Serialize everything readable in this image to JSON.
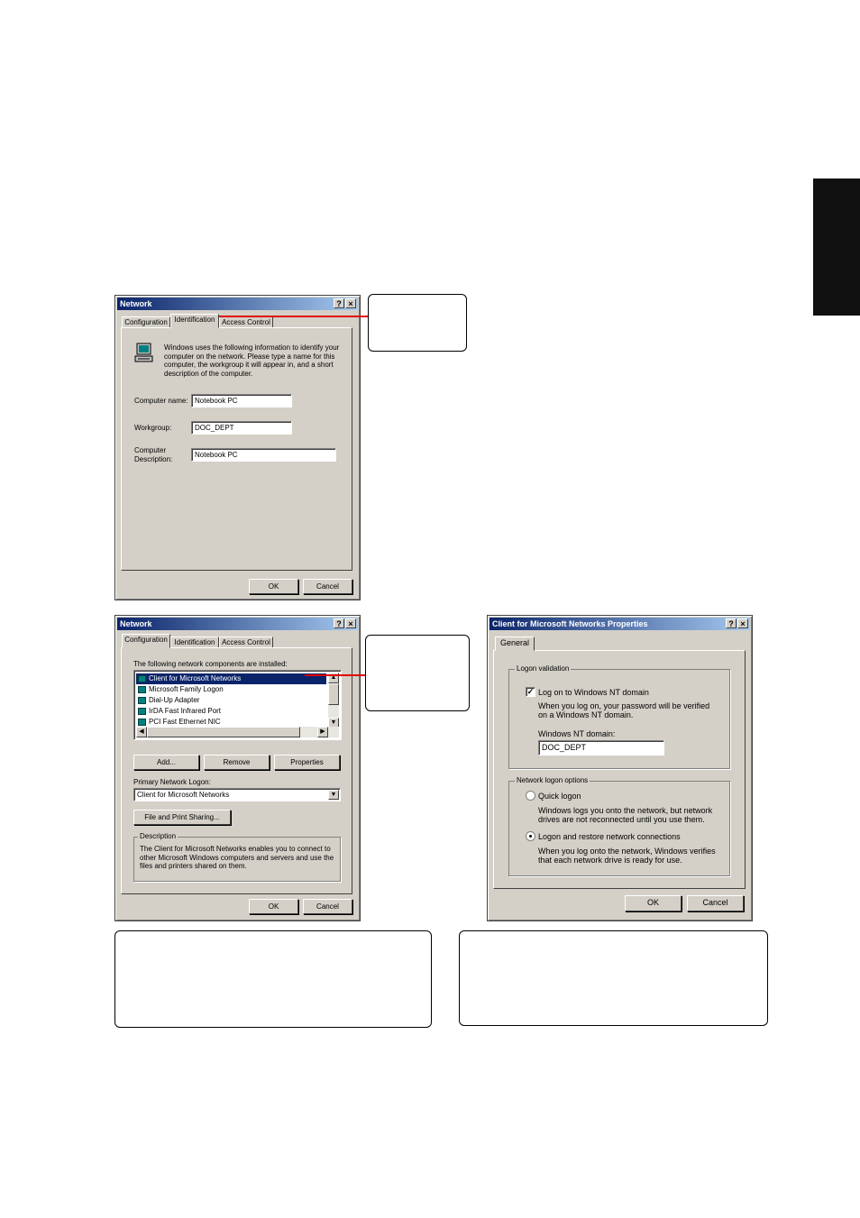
{
  "dialog1": {
    "title": "Network",
    "help_btn": "?",
    "close_btn": "×",
    "tabs": [
      "Configuration",
      "Identification",
      "Access Control"
    ],
    "intro": "Windows uses the following information to identify your computer on the network.  Please type a name for this computer, the workgroup it will appear in, and a short description of the computer.",
    "computer_name_label": "Computer name:",
    "computer_name_value": "Notebook PC",
    "workgroup_label": "Workgroup:",
    "workgroup_value": "DOC_DEPT",
    "description_label_1": "Computer",
    "description_label_2": "Description:",
    "description_value": "Notebook PC",
    "ok": "OK",
    "cancel": "Cancel"
  },
  "dialog2": {
    "title": "Network",
    "help_btn": "?",
    "close_btn": "×",
    "tabs": [
      "Configuration",
      "Identification",
      "Access Control"
    ],
    "list_label": "The following network components are installed:",
    "components": [
      "Client for Microsoft Networks",
      "Microsoft Family Logon",
      "Dial-Up Adapter",
      "IrDA Fast Infrared Port",
      "PCI Fast Ethernet NIC"
    ],
    "add": "Add...",
    "remove": "Remove",
    "properties": "Properties",
    "primary_logon_label": "Primary Network Logon:",
    "primary_logon_value": "Client for Microsoft Networks",
    "file_print": "File and Print Sharing...",
    "description_title": "Description",
    "description_text": "The Client for Microsoft Networks enables you to connect to other Microsoft Windows computers and servers and use the files and printers shared on them.",
    "ok": "OK",
    "cancel": "Cancel"
  },
  "dialog3": {
    "title": "Client for Microsoft Networks Properties",
    "help_btn": "?",
    "close_btn": "×",
    "tab": "General",
    "logon_validation": "Logon validation",
    "logon_nt_label": "Log on to Windows NT domain",
    "logon_nt_desc": "When you log on, your password will be verified on a Windows NT domain.",
    "nt_domain_label": "Windows NT domain:",
    "nt_domain_value": "DOC_DEPT",
    "logon_options": "Network logon options",
    "quick_logon": "Quick logon",
    "quick_desc": "Windows logs you onto the network, but network drives are not reconnected until you use them.",
    "restore_logon": "Logon and restore network connections",
    "restore_desc": "When you log onto the network, Windows verifies that each network drive is ready for use.",
    "ok": "OK",
    "cancel": "Cancel"
  },
  "arrows": {
    "up": "▲",
    "down": "▼",
    "left": "◀",
    "right": "▶",
    "combo": "▼",
    "check": "✓"
  }
}
